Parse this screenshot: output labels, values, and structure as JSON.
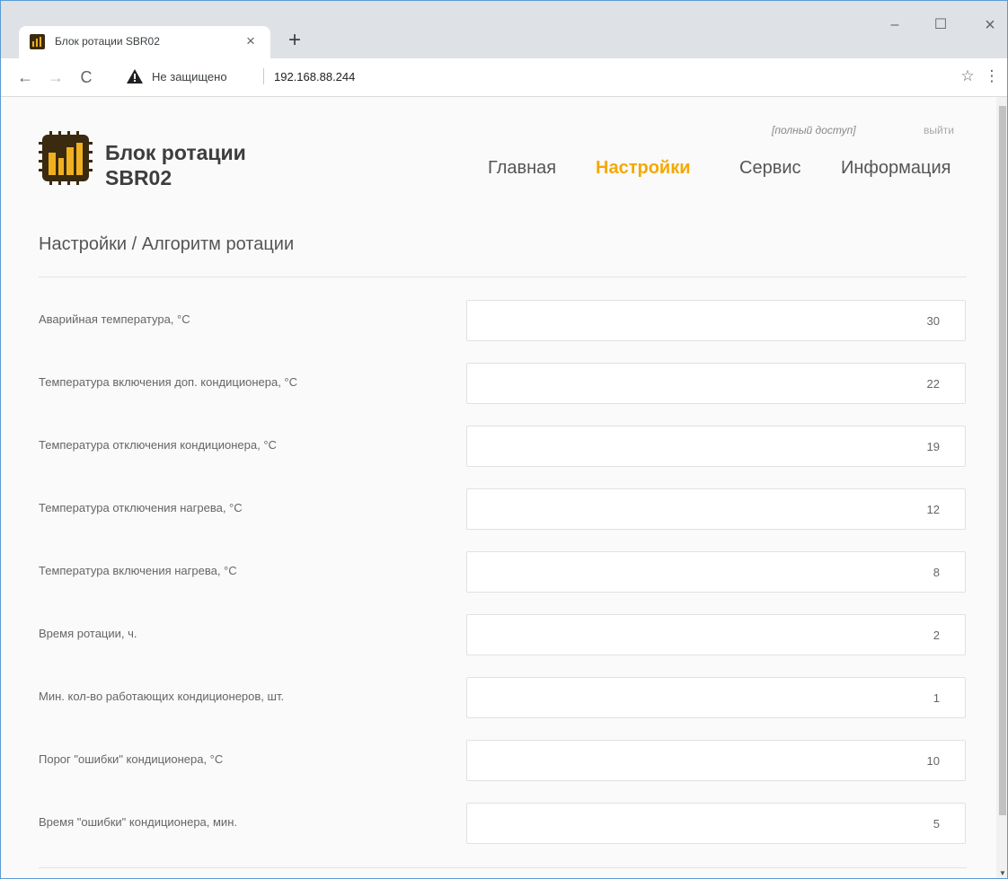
{
  "browser": {
    "tab_title": "Блок ротации SBR02",
    "tab_close": "×",
    "new_tab": "+",
    "win_min": "–",
    "win_max": "☐",
    "win_close": "×",
    "nav_back": "←",
    "nav_forward": "→",
    "nav_reload": "C",
    "security_text": "Не защищено",
    "url": "192.168.88.244",
    "star": "☆",
    "menu": "⋮"
  },
  "header": {
    "access": "[полный доступ]",
    "logout": "выйти",
    "logo_line1": "Блок ротации",
    "logo_line2": "SBR02",
    "nav": {
      "home": "Главная",
      "settings": "Настройки",
      "service": "Сервис",
      "info": "Информация"
    }
  },
  "page": {
    "title": "Настройки / Алгоритм ротации"
  },
  "fields": [
    {
      "label": "Аварийная температура, °C",
      "value": "30"
    },
    {
      "label": "Температура включения доп. кондиционера, °C",
      "value": "22"
    },
    {
      "label": "Температура отключения кондиционера, °C",
      "value": "19"
    },
    {
      "label": "Температура отключения нагрева, °C",
      "value": "12"
    },
    {
      "label": "Температура включения нагрева, °C",
      "value": "8"
    },
    {
      "label": "Время ротации, ч.",
      "value": "2"
    },
    {
      "label": "Мин. кол-во работающих кондиционеров, шт.",
      "value": "1"
    },
    {
      "label": "Порог \"ошибки\" кондиционера, °C",
      "value": "10"
    },
    {
      "label": "Время \"ошибки\" кондиционера, мин.",
      "value": "5"
    }
  ],
  "colors": {
    "accent": "#f5a800",
    "logo_dark": "#3a2a10",
    "logo_light": "#f0b020"
  }
}
